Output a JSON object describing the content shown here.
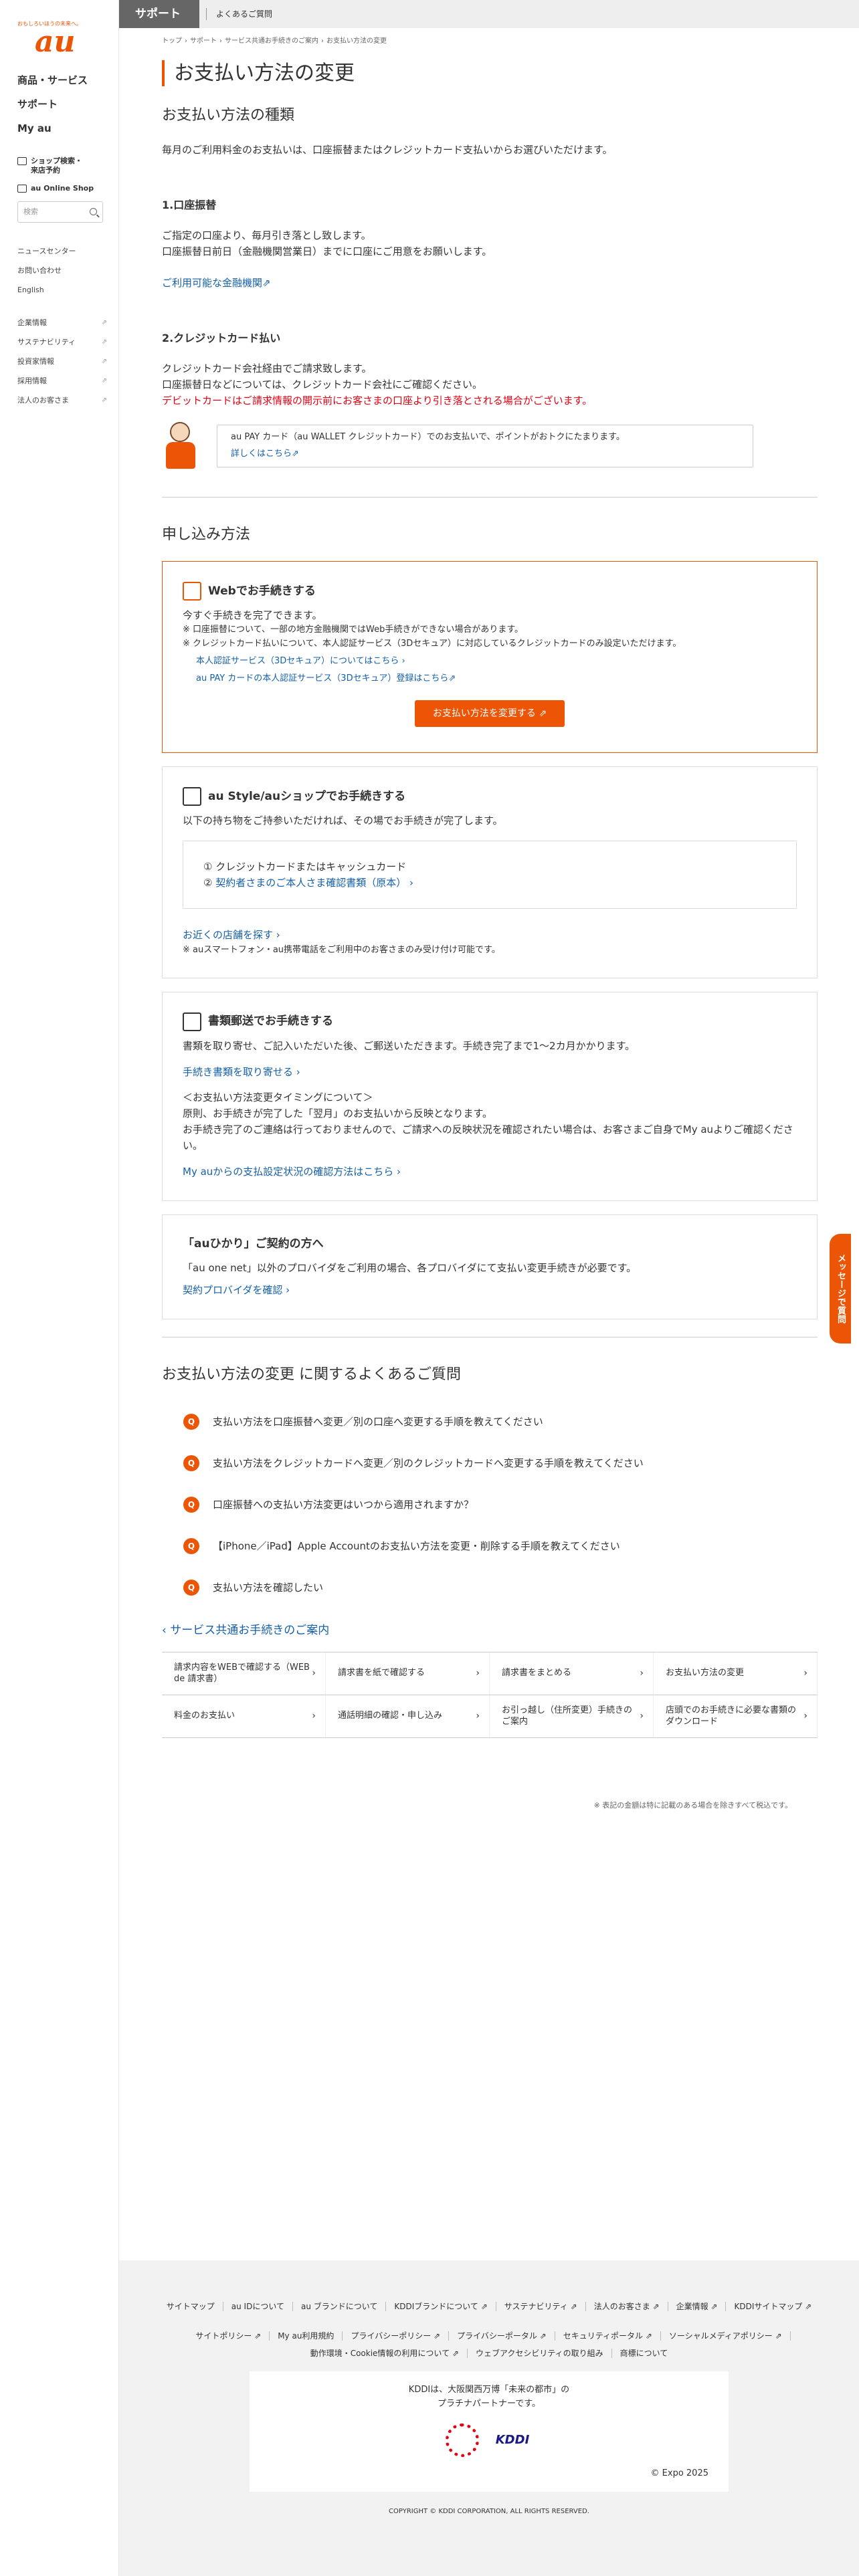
{
  "brand": {
    "tagline": "おもしろいほうの未来へ。",
    "logo": "au"
  },
  "sidebar": {
    "main": [
      "商品・サービス",
      "サポート",
      "My au"
    ],
    "sub": [
      "ショップ検索・来店予約",
      "au Online Shop"
    ],
    "search_placeholder": "検索",
    "list1": [
      "ニュースセンター",
      "お問い合わせ",
      "English"
    ],
    "list2": [
      "企業情報",
      "サステナビリティ",
      "投資家情報",
      "採用情報",
      "法人のお客さま"
    ]
  },
  "topbar": {
    "title": "サポート",
    "link": "よくあるご質問"
  },
  "breadcrumb": [
    "トップ",
    "›",
    "サポート",
    "›",
    "サービス共通お手続きのご案内",
    "›",
    "お支払い方法の変更"
  ],
  "page_title": "お支払い方法の変更",
  "types": {
    "title": "お支払い方法の種類",
    "lead": "毎月のご利用料金のお支払いは、口座振替またはクレジットカード支払いからお選びいただけます。",
    "bank": {
      "title": "1.口座振替",
      "line1": "ご指定の口座より、毎月引き落とし致します。",
      "line2": "口座振替日前日（金融機関営業日）までに口座にご用意をお願いします。",
      "link": "ご利用可能な金融機関⇗"
    },
    "card": {
      "title": "2.クレジットカード払い",
      "line1": "クレジットカード会社経由でご請求致します。",
      "line2": "口座振替日などについては、クレジットカード会社にご確認ください。",
      "warn": "デビットカードはご請求情報の開示前にお客さまの口座より引き落とされる場合がございます。"
    },
    "promo": {
      "text": "au PAY カード（au WALLET クレジットカード）でのお支払いで、ポイントがおトクにたまります。",
      "link": "詳しくはこちら⇗"
    }
  },
  "apply": {
    "title": "申し込み方法",
    "web": {
      "title": "Webでお手続きする",
      "lead": "今すぐ手続きを完了できます。",
      "note1": "※ 口座振替について、一部の地方金融機関ではWeb手続きができない場合があります。",
      "note2": "※ クレジットカード払いについて、本人認証サービス（3Dセキュア）に対応しているクレジットカードのみ設定いただけます。",
      "link1": "本人認証サービス（3Dセキュア）についてはこちら ›",
      "link2": "au PAY カードの本人認証サービス（3Dセキュア）登録はこちら⇗",
      "button": "お支払い方法を変更する ⇗"
    },
    "shop": {
      "title": "au Style/auショップでお手続きする",
      "lead": "以下の持ち物をご持参いただければ、その場でお手続きが完了します。",
      "item1": "① クレジットカードまたはキャッシュカード",
      "item2_prefix": "② ",
      "item2_link": "契約者さまのご本人さま確認書類（原本） ›",
      "link": "お近くの店舗を探す ›",
      "note": "※ auスマートフォン・au携帯電話をご利用中のお客さまのみ受け付け可能です。"
    },
    "mail": {
      "title": "書類郵送でお手続きする",
      "lead": "書類を取り寄せ、ご記入いただいた後、ご郵送いただきます。手続き完了まで1〜2カ月かかります。",
      "link": "手続き書類を取り寄せる ›",
      "timing_title": "＜お支払い方法変更タイミングについて＞",
      "timing1": "原則、お手続きが完了した「翌月」のお支払いから反映となります。",
      "timing2": "お手続き完了のご連絡は行っておりませんので、ご請求への反映状況を確認されたい場合は、お客さまご自身でMy auよりご確認ください。",
      "link2": "My auからの支払設定状況の確認方法はこちら ›"
    },
    "hikari": {
      "title": "「auひかり」ご契約の方へ",
      "lead": "「au one net」以外のプロバイダをご利用の場合、各プロバイダにて支払い変更手続きが必要です。",
      "link": "契約プロバイダを確認 ›"
    }
  },
  "faq": {
    "title": "お支払い方法の変更 に関するよくあるご質問",
    "badge": "Q",
    "items": [
      "支払い方法を口座振替へ変更／別の口座へ変更する手順を教えてください",
      "支払い方法をクレジットカードへ変更／別のクレジットカードへ変更する手順を教えてください",
      "口座振替への支払い方法変更はいつから適用されますか？",
      "【iPhone／iPad】Apple Accountのお支払い方法を変更・削除する手順を教えてください",
      "支払い方法を確認したい"
    ]
  },
  "service": {
    "link": "‹ サービス共通お手続きのご案内",
    "items": [
      "請求内容をWEBで確認する（WEB de 請求書）",
      "請求書を紙で確認する",
      "請求書をまとめる",
      "お支払い方法の変更",
      "料金のお支払い",
      "通話明細の確認・申し込み",
      "お引っ越し（住所変更）手続きのご案内",
      "店頭でのお手続きに必要な書類のダウンロード"
    ],
    "arrow": "›"
  },
  "disclaimer": "※ 表記の金額は特に記載のある場合を除きすべて税込です。",
  "msg_tab": "メッセージで質問",
  "footer": {
    "row1": [
      "サイトマップ",
      "au IDについて",
      "au ブランドについて",
      "KDDIブランドについて ⇗",
      "サステナビリティ ⇗",
      "法人のお客さま ⇗",
      "企業情報 ⇗",
      "KDDIサイトマップ ⇗"
    ],
    "row2": [
      "サイトポリシー ⇗",
      "My au利用規約",
      "プライバシーポリシー ⇗",
      "プライバシーポータル ⇗",
      "セキュリティポータル ⇗",
      "ソーシャルメディアポリシー ⇗",
      "動作環境・Cookie情報の利用について ⇗",
      "ウェブアクセシビリティの取り組み",
      "商標について"
    ],
    "expo_line1": "KDDIは、大阪関西万博「未来の都市」の",
    "expo_line2": "プラチナパートナーです。",
    "expo_logo": "EXPO 2025",
    "kddi_logo": "KDDI",
    "expo_copy": "© Expo 2025",
    "copyright": "COPYRIGHT © KDDI CORPORATION, ALL RIGHTS RESERVED."
  }
}
